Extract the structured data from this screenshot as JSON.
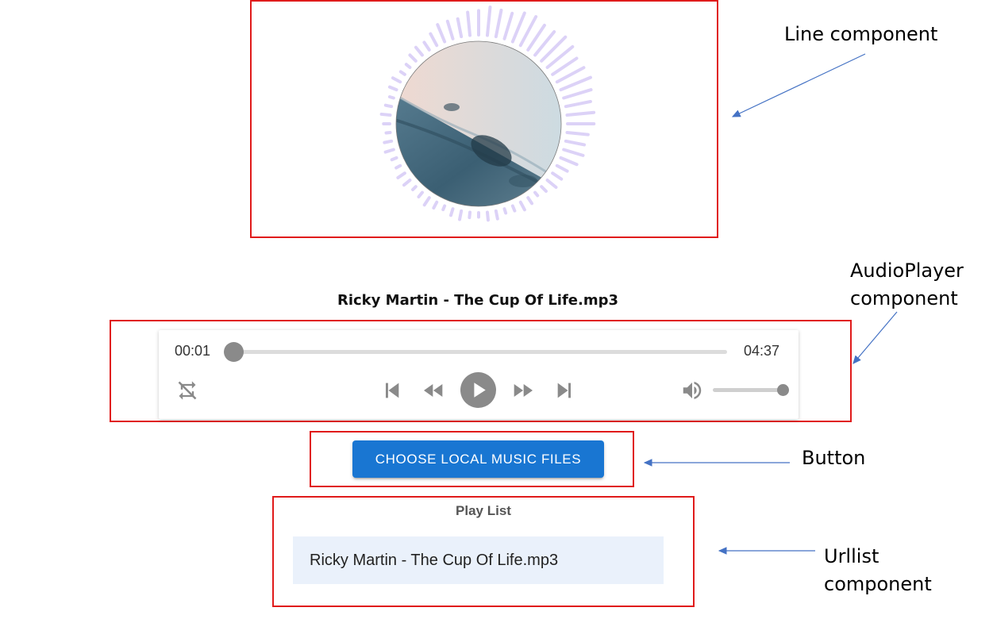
{
  "annotations": {
    "line_component": "Line component",
    "audioplayer_line1": "AudioPlayer",
    "audioplayer_line2": "component",
    "button_label": "Button",
    "urllist_line1": "Urllist",
    "urllist_line2": "component"
  },
  "player": {
    "song_title": "Ricky Martin - The Cup Of Life.mp3",
    "current_time": "00:01",
    "duration": "04:37",
    "progress": 0.004,
    "volume": 1.0
  },
  "button": {
    "label": "CHOOSE LOCAL MUSIC FILES"
  },
  "playlist": {
    "title": "Play List",
    "items": [
      "Ricky Martin - The Cup Of Life.mp3"
    ]
  },
  "colors": {
    "annotation_box": "#e01b1b",
    "arrow": "#4472c4",
    "button_bg": "#1976d2",
    "visualizer_bars": "#dcd2f7",
    "playlist_item_bg": "#eaf1fb",
    "control_icons": "#8a8a8a"
  },
  "icons": {
    "repeat": "repeat-off-icon",
    "prev": "skip-previous-icon",
    "rewind": "rewind-icon",
    "play": "play-icon",
    "forward": "fast-forward-icon",
    "next": "skip-next-icon",
    "volume": "volume-icon"
  }
}
